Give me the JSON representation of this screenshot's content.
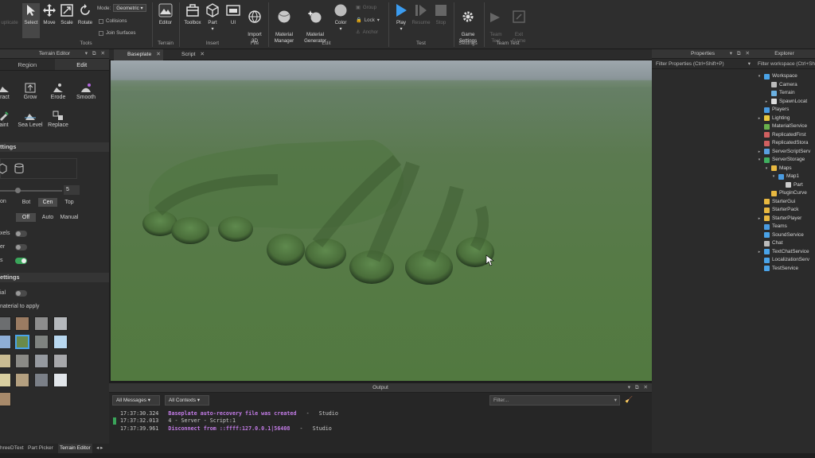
{
  "ribbon": {
    "buttons": {
      "select": "Select",
      "move": "Move",
      "scale": "Scale",
      "rotate": "Rotate",
      "editor": "Editor",
      "toolbox": "Toolbox",
      "part": "Part",
      "ui": "UI",
      "import3d": "Import\n3D",
      "material_manager": "Material\nManager",
      "material_generator": "Material\nGenerator",
      "color": "Color",
      "play": "Play",
      "resume": "Resume",
      "stop": "Stop",
      "game_settings": "Game\nSettings",
      "team_test": "Team\nTest",
      "exit_game": "Exit\nGame",
      "group": "Group",
      "lock": "Lock",
      "anchor": "Anchor"
    },
    "left_fragment": "uplicate",
    "mode_label": "Mode:",
    "mode_value": "Geometric",
    "collisions": "Collisions",
    "join_surfaces": "Join Surfaces",
    "groups": {
      "tools": "Tools",
      "terrain": "Terrain",
      "insert": "Insert",
      "file": "File",
      "edit": "Edit",
      "test": "Test",
      "settings": "Settings",
      "team_test": "Team Test"
    }
  },
  "terrain_editor": {
    "title": "Terrain Editor",
    "tabs": [
      "Region",
      "Edit"
    ],
    "tools": [
      "tract",
      "Grow",
      "Erode",
      "Smooth",
      "aint",
      "Sea Level",
      "Replace"
    ],
    "brush_settings": "ttings",
    "brush_size": "5",
    "pivot_label": "on",
    "pivot_options": [
      "Bot",
      "Cen",
      "Top"
    ],
    "plane_options": [
      "Off",
      "Auto",
      "Manual"
    ],
    "rows": [
      "xels",
      "er",
      "s"
    ],
    "material_settings": "ettings",
    "material_row": "ial",
    "material_hint": "naterial to apply"
  },
  "doc_tabs": [
    {
      "label": "Baseplate",
      "active": true
    },
    {
      "label": "Script",
      "active": false
    }
  ],
  "output": {
    "title": "Output",
    "filter_messages": "All Messages",
    "filter_contexts": "All Contexts",
    "filter_placeholder": "Filter...",
    "lines": [
      {
        "time": "17:37:30.324",
        "msg": "Baseplate auto-recovery file was created",
        "sep": "-",
        "src": "Studio"
      },
      {
        "time": "17:37:32.013",
        "msg": "4  -  Server - Script:1",
        "sep": "",
        "src": ""
      },
      {
        "time": "17:37:39.961",
        "msg": "Disconnect from ::ffff:127.0.0.1|56408",
        "sep": "-",
        "src": "Studio"
      }
    ]
  },
  "properties": {
    "title": "Properties",
    "filter": "Filter Properties (Ctrl+Shift+P)"
  },
  "explorer": {
    "title": "Explorer",
    "filter": "Filter workspace (Ctrl+Sh",
    "items": [
      {
        "label": "Workspace",
        "icon": "globe-icon",
        "color": "#4aa3e8"
      },
      {
        "label": "Camera",
        "icon": "camera-icon",
        "color": "#bbbbbb"
      },
      {
        "label": "Terrain",
        "icon": "terrain-icon",
        "color": "#6bb0e0"
      },
      {
        "label": "SpawnLocat",
        "icon": "spawn-icon",
        "color": "#dddddd"
      },
      {
        "label": "Players",
        "icon": "players-icon",
        "color": "#4a9be0"
      },
      {
        "label": "Lighting",
        "icon": "bulb-icon",
        "color": "#e8c840"
      },
      {
        "label": "MaterialService",
        "icon": "material-icon",
        "color": "#6ab04c"
      },
      {
        "label": "ReplicatedFirst",
        "icon": "replicated-icon",
        "color": "#d06060"
      },
      {
        "label": "ReplicatedStora",
        "icon": "replicated-storage-icon",
        "color": "#d06060"
      },
      {
        "label": "ServerScriptServ",
        "icon": "script-service-icon",
        "color": "#5aa0e0"
      },
      {
        "label": "ServerStorage",
        "icon": "server-storage-icon",
        "color": "#40b060"
      },
      {
        "label": "Maps",
        "icon": "folder-icon",
        "color": "#e8b840"
      },
      {
        "label": "Map1",
        "icon": "model-icon",
        "color": "#4a9be0"
      },
      {
        "label": "Part",
        "icon": "part-icon",
        "color": "#cccccc"
      },
      {
        "label": "PluginCurve",
        "icon": "folder-icon",
        "color": "#e8b840"
      },
      {
        "label": "StarterGui",
        "icon": "gui-icon",
        "color": "#e8b840"
      },
      {
        "label": "StarterPack",
        "icon": "pack-icon",
        "color": "#e8b840"
      },
      {
        "label": "StarterPlayer",
        "icon": "player-icon",
        "color": "#e8b840"
      },
      {
        "label": "Teams",
        "icon": "teams-icon",
        "color": "#4a9be0"
      },
      {
        "label": "SoundService",
        "icon": "sound-icon",
        "color": "#4aa3e8"
      },
      {
        "label": "Chat",
        "icon": "chat-icon",
        "color": "#bbbbbb"
      },
      {
        "label": "TextChatService",
        "icon": "textchat-icon",
        "color": "#4aa3e8"
      },
      {
        "label": "LocalizationServ",
        "icon": "localization-icon",
        "color": "#4aa3e8"
      },
      {
        "label": "TestService",
        "icon": "test-icon",
        "color": "#4aa3e8"
      }
    ]
  },
  "bottom_tabs": [
    "hreeDText",
    "Part Picker",
    "Terrain Editor"
  ],
  "colors": {
    "accent": "#3aa55a",
    "play": "#3b9cf0",
    "output_highlight": "#c27be6"
  }
}
